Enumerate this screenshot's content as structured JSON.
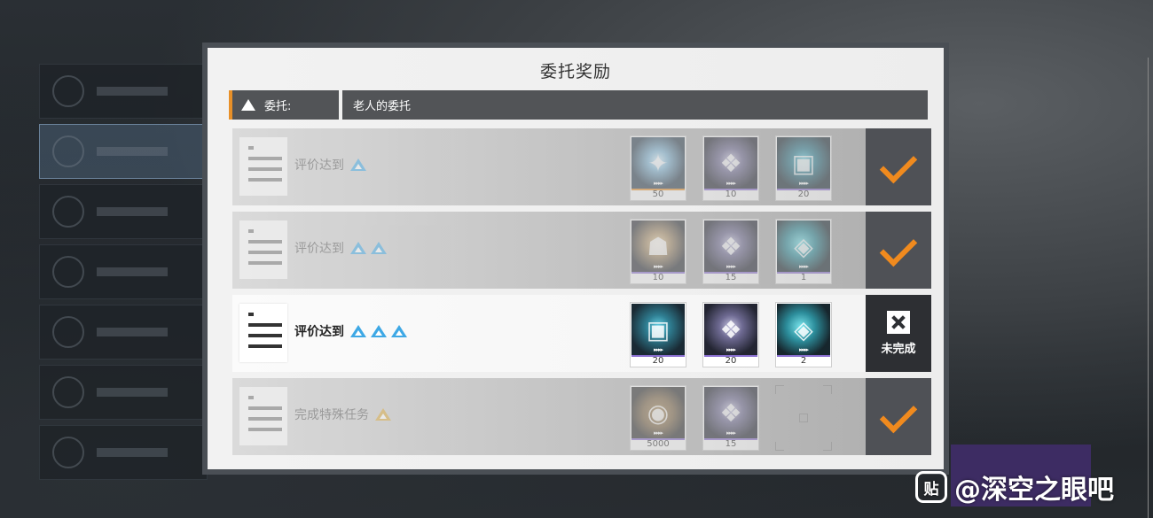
{
  "dialog": {
    "title": "委托奖励",
    "header_label": "委托:",
    "header_value": "老人的委托"
  },
  "rows": [
    {
      "text": "评价达到",
      "rank_icons": 1,
      "rank_color": "#3ea8e5",
      "status": "complete",
      "rewards": [
        {
          "icon": "star-shard-icon",
          "qty": "50"
        },
        {
          "icon": "feather-relic-icon",
          "qty": "10"
        },
        {
          "icon": "data-cube-icon",
          "qty": "20"
        }
      ]
    },
    {
      "text": "评价达到",
      "rank_icons": 2,
      "rank_color": "#3ea8e5",
      "status": "complete",
      "rewards": [
        {
          "icon": "character-figure-icon",
          "qty": "10"
        },
        {
          "icon": "feather-relic-icon",
          "qty": "15"
        },
        {
          "icon": "crystal-cluster-icon",
          "qty": "1"
        }
      ]
    },
    {
      "text": "评价达到",
      "rank_icons": 3,
      "rank_color": "#3ea8e5",
      "status": "incomplete",
      "status_label": "未完成",
      "rewards": [
        {
          "icon": "data-cube-icon",
          "qty": "20"
        },
        {
          "icon": "feather-relic-icon",
          "qty": "20"
        },
        {
          "icon": "crystal-cluster-icon",
          "qty": "2"
        }
      ]
    },
    {
      "text": "完成特殊任务",
      "rank_icons": 1,
      "rank_color": "#d9a93a",
      "status": "complete",
      "rewards": [
        {
          "icon": "gold-coin-icon",
          "qty": "5000"
        },
        {
          "icon": "feather-relic-icon",
          "qty": "15"
        },
        {
          "icon": "empty-slot-icon",
          "qty": ""
        }
      ]
    }
  ],
  "watermark": {
    "logo": "贴",
    "text": "@深空之眼吧"
  },
  "colors": {
    "accent_orange": "#f08a1e",
    "rank_blue": "#3ea8e5",
    "rank_gold": "#d9a93a"
  }
}
